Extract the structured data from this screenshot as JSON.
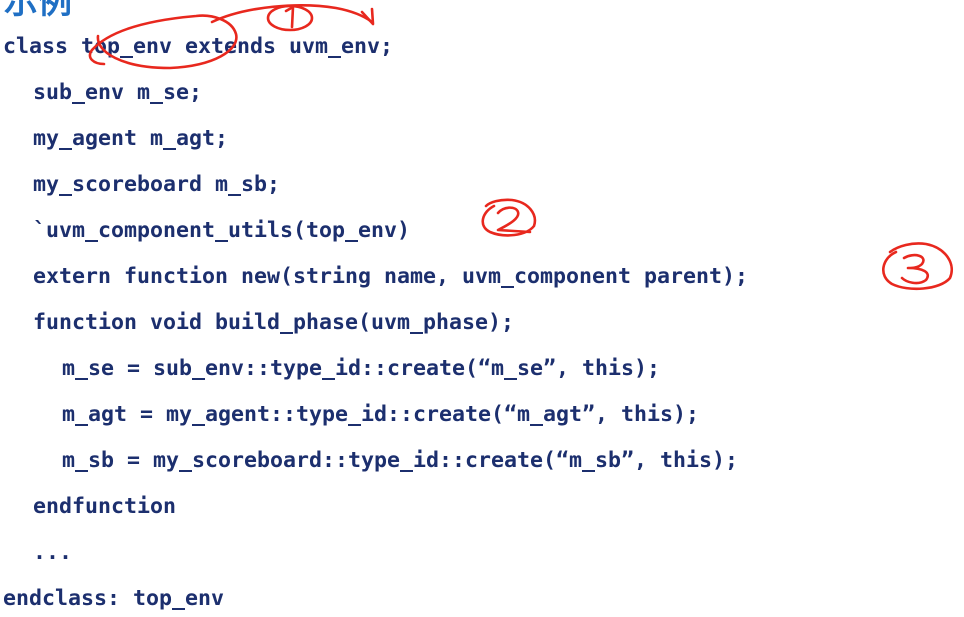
{
  "title": "示例",
  "code_lines": [
    "class top_env extends uvm_env;",
    "sub_env m_se;",
    "my_agent m_agt;",
    "my_scoreboard m_sb;",
    "`uvm_component_utils(top_env)",
    "extern function new(string name, uvm_component parent);",
    "function void build_phase(uvm_phase);",
    "m_se = sub_env::type_id::create(“m_se”, this);",
    "m_agt = my_agent::type_id::create(“m_agt”, this);",
    "m_sb = my_scoreboard::type_id::create(“m_sb”, this);",
    "endfunction",
    "...",
    "endclass: top_env"
  ],
  "annotations": {
    "circle_1_label": "1",
    "circle_2_label": "2",
    "circle_3_label": "3"
  },
  "colors": {
    "code": "#1c2f6e",
    "title": "#1f6fc4",
    "annotation": "#e8281e"
  }
}
